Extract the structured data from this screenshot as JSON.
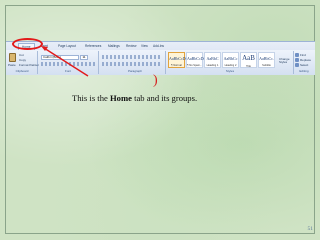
{
  "ribbon": {
    "tabs": [
      "Home",
      "Insert",
      "Page Layout",
      "References",
      "Mailings",
      "Review",
      "View",
      "Add-Ins"
    ],
    "clipboard": {
      "paste": "Paste",
      "cut": "Cut",
      "copy": "Copy",
      "format_painter": "Format Painter",
      "label": "Clipboard"
    },
    "font": {
      "name": "Calibri (Body)",
      "size": "11",
      "label": "Font"
    },
    "paragraph": {
      "label": "Paragraph"
    },
    "styles": {
      "items": [
        {
          "sample": "AaBbCcDc",
          "name": "¶ Normal",
          "selected": true
        },
        {
          "sample": "AaBbCcDc",
          "name": "¶ No Spaci...",
          "selected": false
        },
        {
          "sample": "AaBbC",
          "name": "Heading 1",
          "selected": false
        },
        {
          "sample": "AaBbCc",
          "name": "Heading 2",
          "selected": false
        },
        {
          "sample": "AaB",
          "name": "Title",
          "selected": false
        },
        {
          "sample": "AaBbCc.",
          "name": "Subtitle",
          "selected": false
        }
      ],
      "change_styles": "Change Styles",
      "label": "Styles"
    },
    "editing": {
      "find": "Find",
      "replace": "Replace",
      "select": "Select",
      "label": "Editing"
    }
  },
  "annotation": {
    "caption_prefix": "This is the ",
    "caption_bold": "Home",
    "caption_suffix": " tab and its groups.",
    "highlight_color": "#e21a1a"
  },
  "slide": {
    "page_number": "51"
  }
}
